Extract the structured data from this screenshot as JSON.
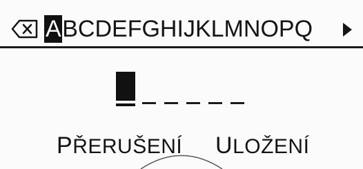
{
  "char_selector": {
    "backspace_icon": "backspace-icon",
    "characters": [
      "A",
      "B",
      "C",
      "D",
      "E",
      "F",
      "G",
      "H",
      "I",
      "J",
      "K",
      "L",
      "M",
      "N",
      "O",
      "P",
      "Q"
    ],
    "selected_index": 0,
    "next_icon": "triangle-right-icon"
  },
  "entry": {
    "total_slots": 6,
    "filled_count": 0,
    "active_slot": 0
  },
  "softkeys": {
    "cancel_first": "P",
    "cancel_rest": "ŘERUŠENÍ",
    "save_first": "U",
    "save_rest": "LOŽENÍ"
  },
  "colors": {
    "foreground": "#111111",
    "background": "#fbfbfb",
    "selection_bg": "#111111",
    "selection_fg": "#ffffff"
  }
}
